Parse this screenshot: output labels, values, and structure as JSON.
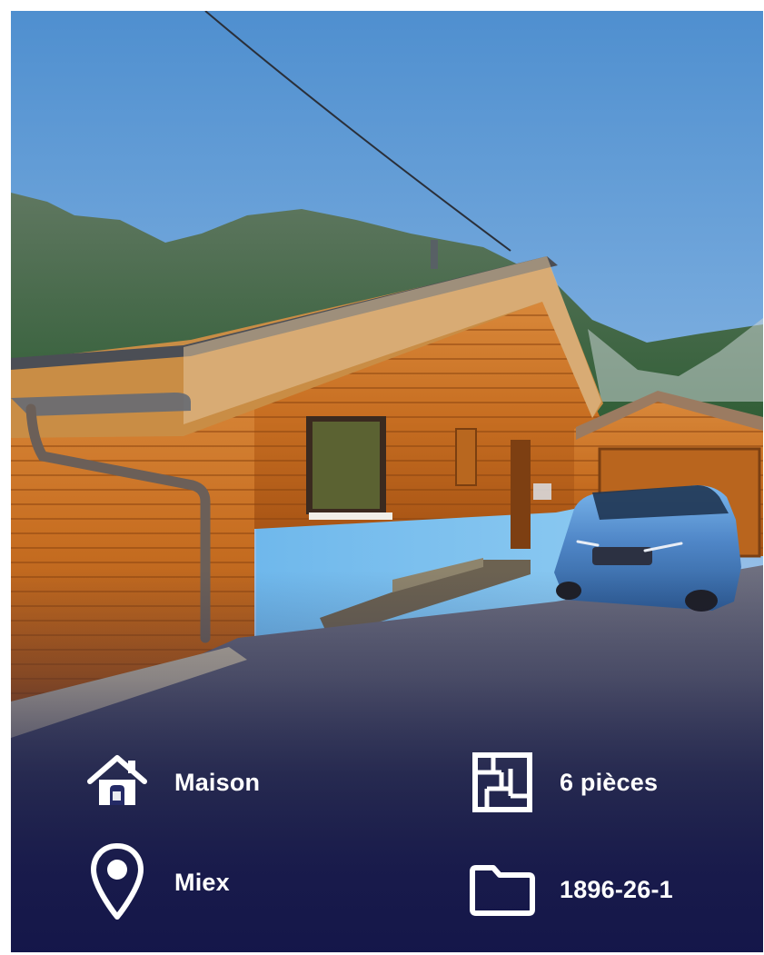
{
  "features": [
    {
      "icon": "house-icon",
      "label": "Maison"
    },
    {
      "icon": "floorplan-icon",
      "label": "6 pièces"
    },
    {
      "icon": "location-pin-icon",
      "label": "Miex"
    },
    {
      "icon": "folder-icon",
      "label": "1896-26-1"
    }
  ],
  "colors": {
    "overlay": "#1f2455",
    "text": "#ffffff",
    "wall_blue": "#6fb7e8",
    "wood": "#c46d22",
    "car_blue": "#4a83c0"
  }
}
